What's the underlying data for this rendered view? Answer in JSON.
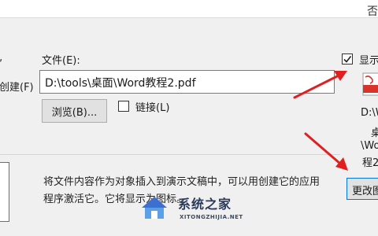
{
  "window": {
    "title_fragment": "否"
  },
  "left_options": {
    "option_1_fragment": "),",
    "option_2_fragment": "创建(F)"
  },
  "file": {
    "label": "文件(E):",
    "path_value": "D:\\tools\\桌面\\Word教程2.pdf",
    "browse_label": "浏览(B)...",
    "link_label": "链接(L)",
    "link_checked": false
  },
  "display": {
    "label_fragment": "显示",
    "checked": true
  },
  "icon_preview": {
    "icon_name": "pdf-file-icon",
    "caption_lines": [
      "D:\\Wo",
      "桌",
      "\\Word",
      "程2."
    ]
  },
  "change_icon": {
    "label_fragment": "更改图"
  },
  "result": {
    "description_line_1": "将文件内容作为对象插入到演示文稿中，可以用创建它的应用",
    "description_line_2": "程序激活它。它将显示为图标。"
  },
  "watermark": {
    "title": "系统之家",
    "url": "XITONGZHIJIA.NET"
  },
  "colors": {
    "arrow": "#e02020",
    "accent_border": "#0078d7",
    "pdf_red": "#d9342b"
  }
}
